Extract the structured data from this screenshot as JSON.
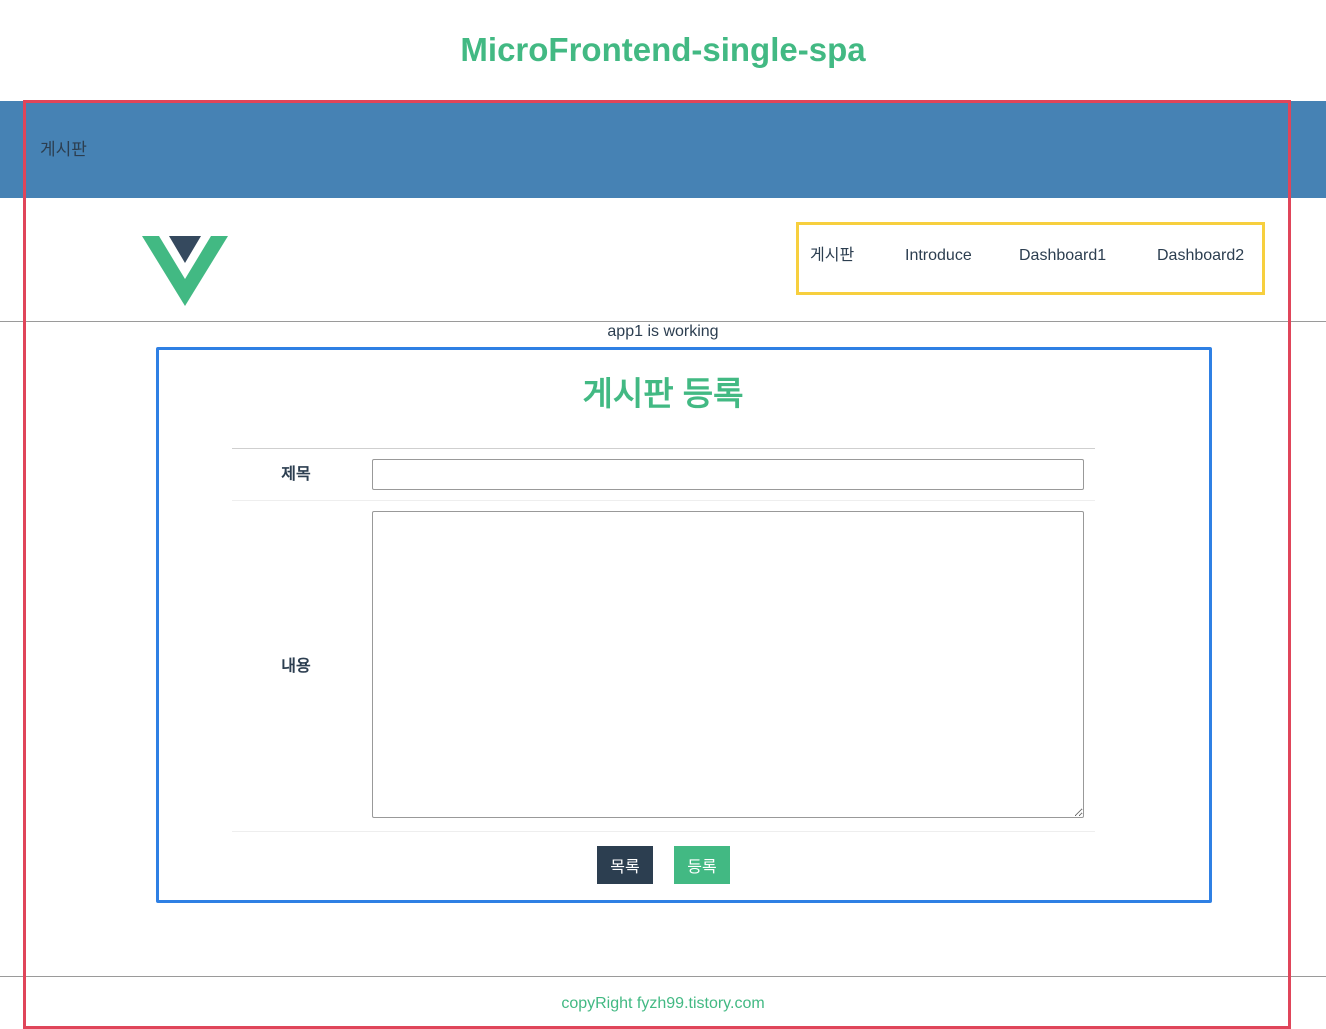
{
  "app": {
    "title": "MicroFrontend-single-spa"
  },
  "topbar": {
    "label": "게시판"
  },
  "logo": {
    "icon": "vue-logo-icon",
    "colors": {
      "outer": "#42b983",
      "inner": "#35495e"
    }
  },
  "nav": {
    "items": [
      {
        "label": "게시판"
      },
      {
        "label": "Introduce"
      },
      {
        "label": "Dashboard1"
      },
      {
        "label": "Dashboard2"
      }
    ]
  },
  "status": {
    "text": "app1 is working"
  },
  "form": {
    "title": "게시판 등록",
    "fields": {
      "subject": {
        "label": "제목",
        "value": ""
      },
      "content": {
        "label": "내용",
        "value": ""
      }
    },
    "buttons": {
      "list_label": "목록",
      "submit_label": "등록"
    }
  },
  "footer": {
    "text": "copyRight fyzh99.tistory.com"
  },
  "colors": {
    "accent": "#42b983",
    "dark": "#2c3e50",
    "topbar": "#4682b4",
    "red_frame": "#e0455a",
    "yellow_frame": "#f7cf3e",
    "blue_frame": "#2f80e4"
  }
}
